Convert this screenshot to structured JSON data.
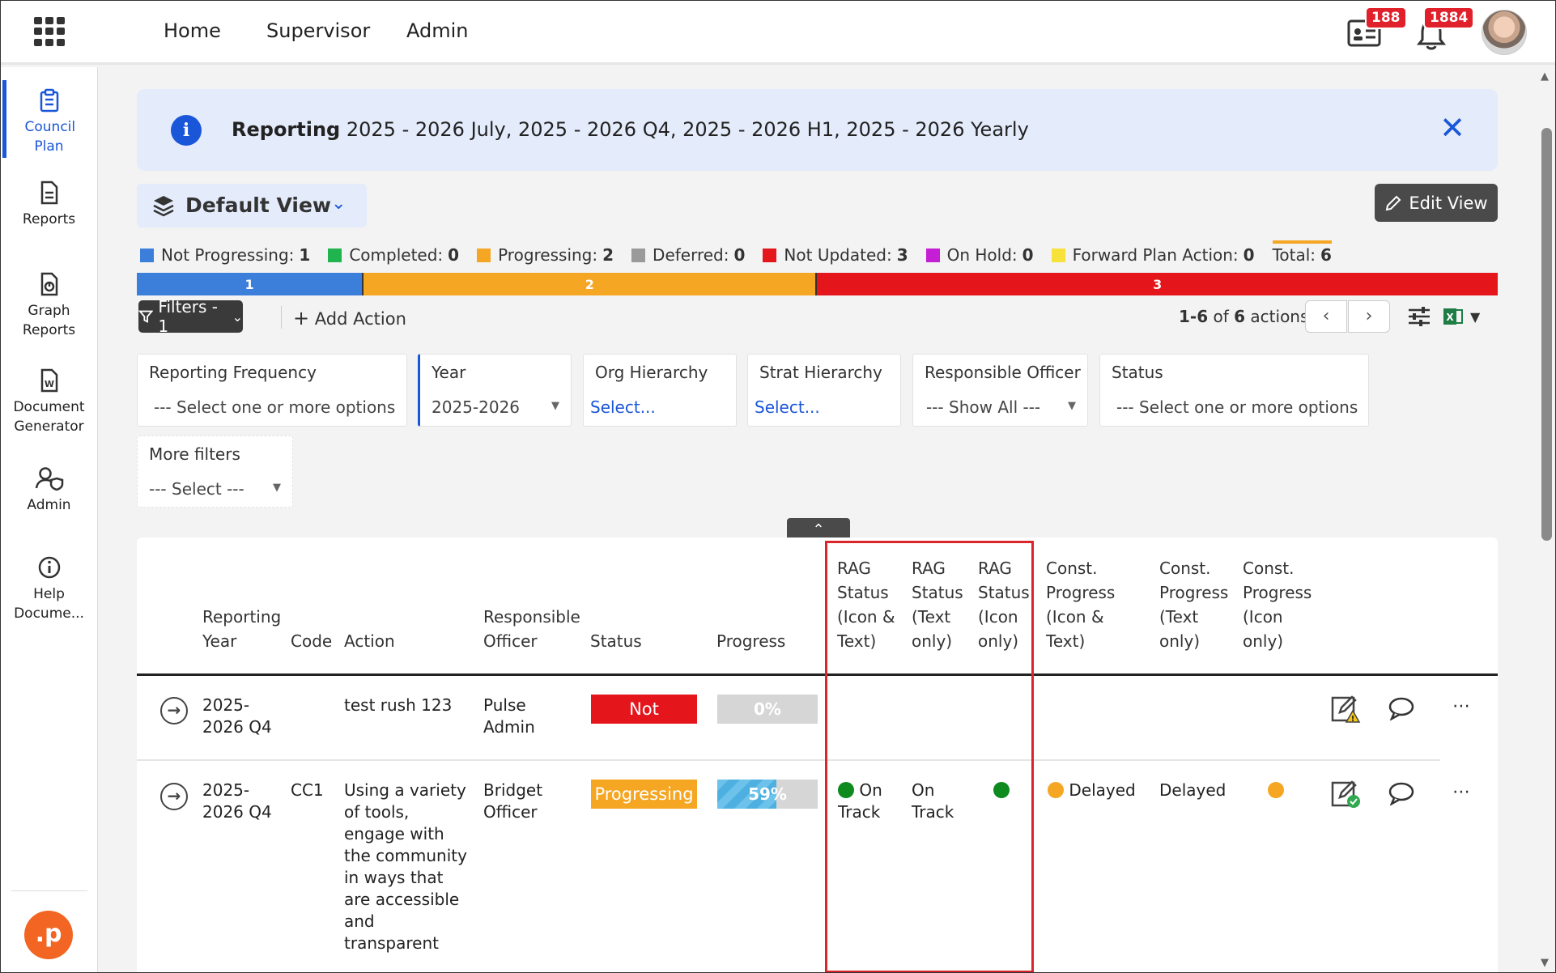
{
  "topnav": {
    "links": [
      "Home",
      "Supervisor",
      "Admin"
    ],
    "contacts_badge": "188",
    "notifications_badge": "1884"
  },
  "sidebar": {
    "items": [
      {
        "label": "Council Plan",
        "icon": "clipboard-icon",
        "active": true
      },
      {
        "label": "Reports",
        "icon": "document-icon"
      },
      {
        "label": "Graph Reports",
        "icon": "graph-document-icon"
      },
      {
        "label": "Document Generator",
        "icon": "word-document-icon"
      },
      {
        "label": "Admin",
        "icon": "user-shield-icon"
      },
      {
        "label": "Help Docume...",
        "icon": "info-circle-icon"
      }
    ],
    "logo": ".p",
    "expand": "»"
  },
  "banner": {
    "bold": "Reporting",
    "text": " 2025 - 2026 July, 2025 - 2026 Q4, 2025 - 2026 H1, 2025 - 2026 Yearly"
  },
  "view": {
    "label": "Default View",
    "edit_label": "Edit View"
  },
  "legend": [
    {
      "label": "Not Progressing:",
      "count": "1",
      "color": "#3b7fdb"
    },
    {
      "label": "Completed:",
      "count": "0",
      "color": "#1fb44d"
    },
    {
      "label": "Progressing:",
      "count": "2",
      "color": "#f5a623"
    },
    {
      "label": "Deferred:",
      "count": "0",
      "color": "#9a9a9a"
    },
    {
      "label": "Not Updated:",
      "count": "3",
      "color": "#e4161c"
    },
    {
      "label": "On Hold:",
      "count": "0",
      "color": "#c51fd6"
    },
    {
      "label": "Forward Plan Action:",
      "count": "0",
      "color": "#f7e13b"
    },
    {
      "label": "Total:",
      "count": "6",
      "color": null
    }
  ],
  "status_bar": [
    {
      "label": "1",
      "value": 1,
      "color": "#3b7fdb"
    },
    {
      "label": "2",
      "value": 2,
      "color": "#f5a623"
    },
    {
      "label": "3",
      "value": 3,
      "color": "#e4161c"
    }
  ],
  "toolbar": {
    "filters_label": "Filters - 1",
    "add_action_label": "Add Action",
    "pager_range": "1-6",
    "pager_of": " of ",
    "pager_total": "6",
    "pager_suffix": " actions"
  },
  "filters": {
    "reporting_frequency": {
      "label": "Reporting Frequency",
      "value": "--- Select one or more options ---"
    },
    "year": {
      "label": "Year",
      "value": "2025-2026"
    },
    "org_hierarchy": {
      "label": "Org Hierarchy",
      "value": "Select..."
    },
    "strat_hierarchy": {
      "label": "Strat Hierarchy",
      "value": "Select..."
    },
    "responsible_officer": {
      "label": "Responsible Officer",
      "value": "--- Show All ---"
    },
    "status": {
      "label": "Status",
      "value": "--- Select one or more options ---"
    },
    "more_filters": {
      "label": "More filters",
      "value": "--- Select ---"
    }
  },
  "table": {
    "headers": {
      "reporting_year": [
        "Reporting",
        "Year"
      ],
      "code": "Code",
      "action": "Action",
      "responsible_officer": [
        "Responsible",
        "Officer"
      ],
      "status": "Status",
      "progress": "Progress",
      "rag_icon_text": [
        "RAG",
        "Status",
        "(Icon &",
        "Text)"
      ],
      "rag_text_only": [
        "RAG",
        "Status",
        "(Text",
        "only)"
      ],
      "rag_icon_only": [
        "RAG",
        "Status",
        "(Icon",
        "only)"
      ],
      "const_icon_text": [
        "Const.",
        "Progress",
        "(Icon &",
        "Text)"
      ],
      "const_text_only": [
        "Const.",
        "Progress",
        "(Text",
        "only)"
      ],
      "const_icon_only": [
        "Const.",
        "Progress",
        "(Icon",
        "only)"
      ]
    },
    "rows": [
      {
        "year": [
          "2025-",
          "2026 Q4"
        ],
        "code": "",
        "action": "test rush 123",
        "officer": [
          "Pulse",
          "Admin"
        ],
        "status": "Not Updated",
        "status_color": "#e4161c",
        "progress_label": "0%",
        "progress": 0
      },
      {
        "year": [
          "2025-",
          "2026 Q4"
        ],
        "code": "CC1",
        "action": [
          "Using a variety",
          "of tools,",
          "engage with",
          "the community",
          "in ways that",
          "are accessible",
          "and",
          "transparent"
        ],
        "officer": [
          "Bridget",
          "Officer"
        ],
        "status": "Progressing",
        "status_color": "#f5a623",
        "progress_label": "59%",
        "progress": 0.59,
        "rag_icon_text": [
          "On",
          "Track"
        ],
        "rag_text_only": [
          "On",
          "Track"
        ],
        "rag_color": "#0e8a1e",
        "const_icon_text": "Delayed",
        "const_text_only": "Delayed",
        "const_color": "#f5a623"
      }
    ]
  }
}
